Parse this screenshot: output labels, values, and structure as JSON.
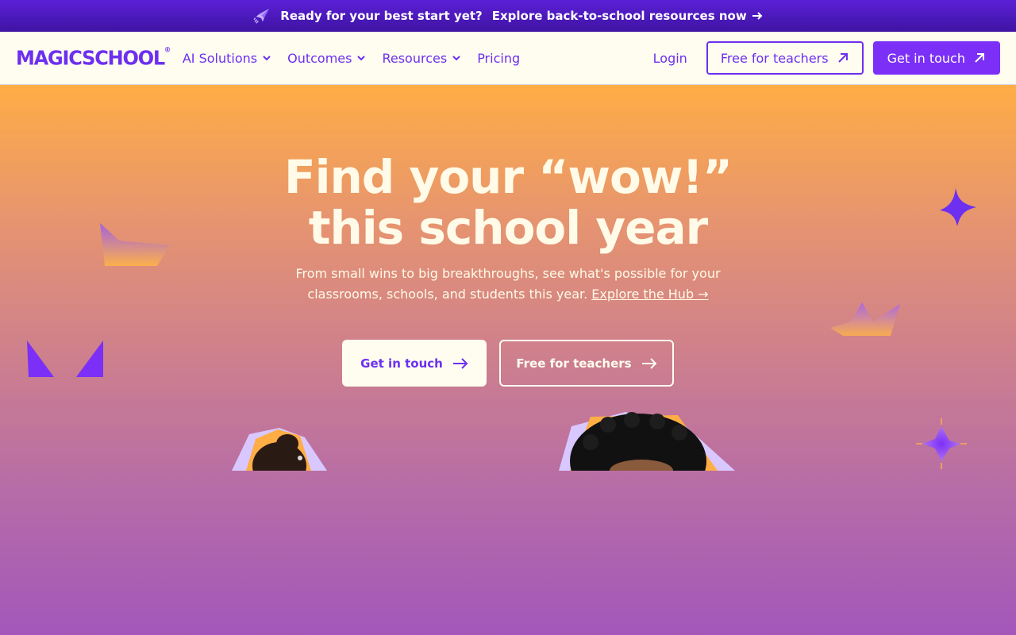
{
  "announcement": {
    "text": "Ready for your best start yet?",
    "link_text": "Explore back-to-school resources now"
  },
  "nav": {
    "logo": "MAGICSCHOOL",
    "logo_mark": "®",
    "items": [
      {
        "label": "AI Solutions",
        "has_dropdown": true
      },
      {
        "label": "Outcomes",
        "has_dropdown": true
      },
      {
        "label": "Resources",
        "has_dropdown": true
      },
      {
        "label": "Pricing",
        "has_dropdown": false
      }
    ],
    "login": "Login",
    "free_for_teachers": "Free for teachers",
    "get_in_touch": "Get in touch"
  },
  "hero": {
    "title_line1": "Find your “wow!”",
    "title_line2": "this school year",
    "subtitle": "From small wins to big breakthroughs, see what's possible for  your classrooms, schools, and students this year.",
    "hub_link": "Explore the Hub →",
    "cta_primary": "Get in touch",
    "cta_secondary": "Free for teachers"
  },
  "colors": {
    "brand_purple": "#6d2ff0",
    "button_purple": "#7b2ff7",
    "cream": "#fefdf0",
    "hero_top": "#ffad45",
    "hero_bottom": "#a357ba"
  }
}
